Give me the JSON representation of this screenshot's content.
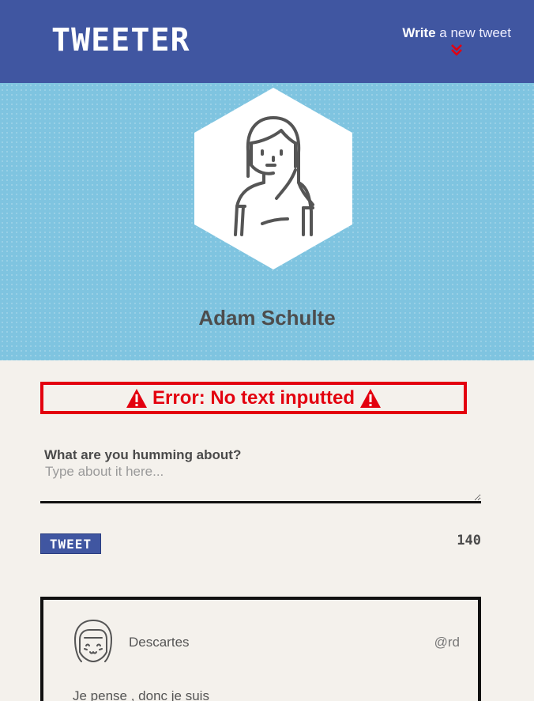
{
  "nav": {
    "logo": "TWEETER",
    "compose_bold": "Write",
    "compose_rest": " a new tweet",
    "chevron_icon": "double-chevron-down-icon"
  },
  "profile": {
    "name": "Adam Schulte",
    "avatar_icon": "woman-avatar-icon"
  },
  "error": {
    "message": "Error: No text inputted",
    "icon": "warning-triangle-icon",
    "color": "#e3000f"
  },
  "compose_form": {
    "question": "What are you humming about?",
    "placeholder": "Type about it here...",
    "value": "",
    "button_label": "TWEET",
    "counter": "140"
  },
  "tweets": [
    {
      "name": "Descartes",
      "handle": "@rd",
      "text": "Je pense , donc je suis",
      "avatar_icon": "girl-avatar-icon"
    }
  ],
  "colors": {
    "nav": "#4056a1",
    "header": "#7fc4e0",
    "background": "#f4f1ec",
    "error": "#e3000f"
  }
}
